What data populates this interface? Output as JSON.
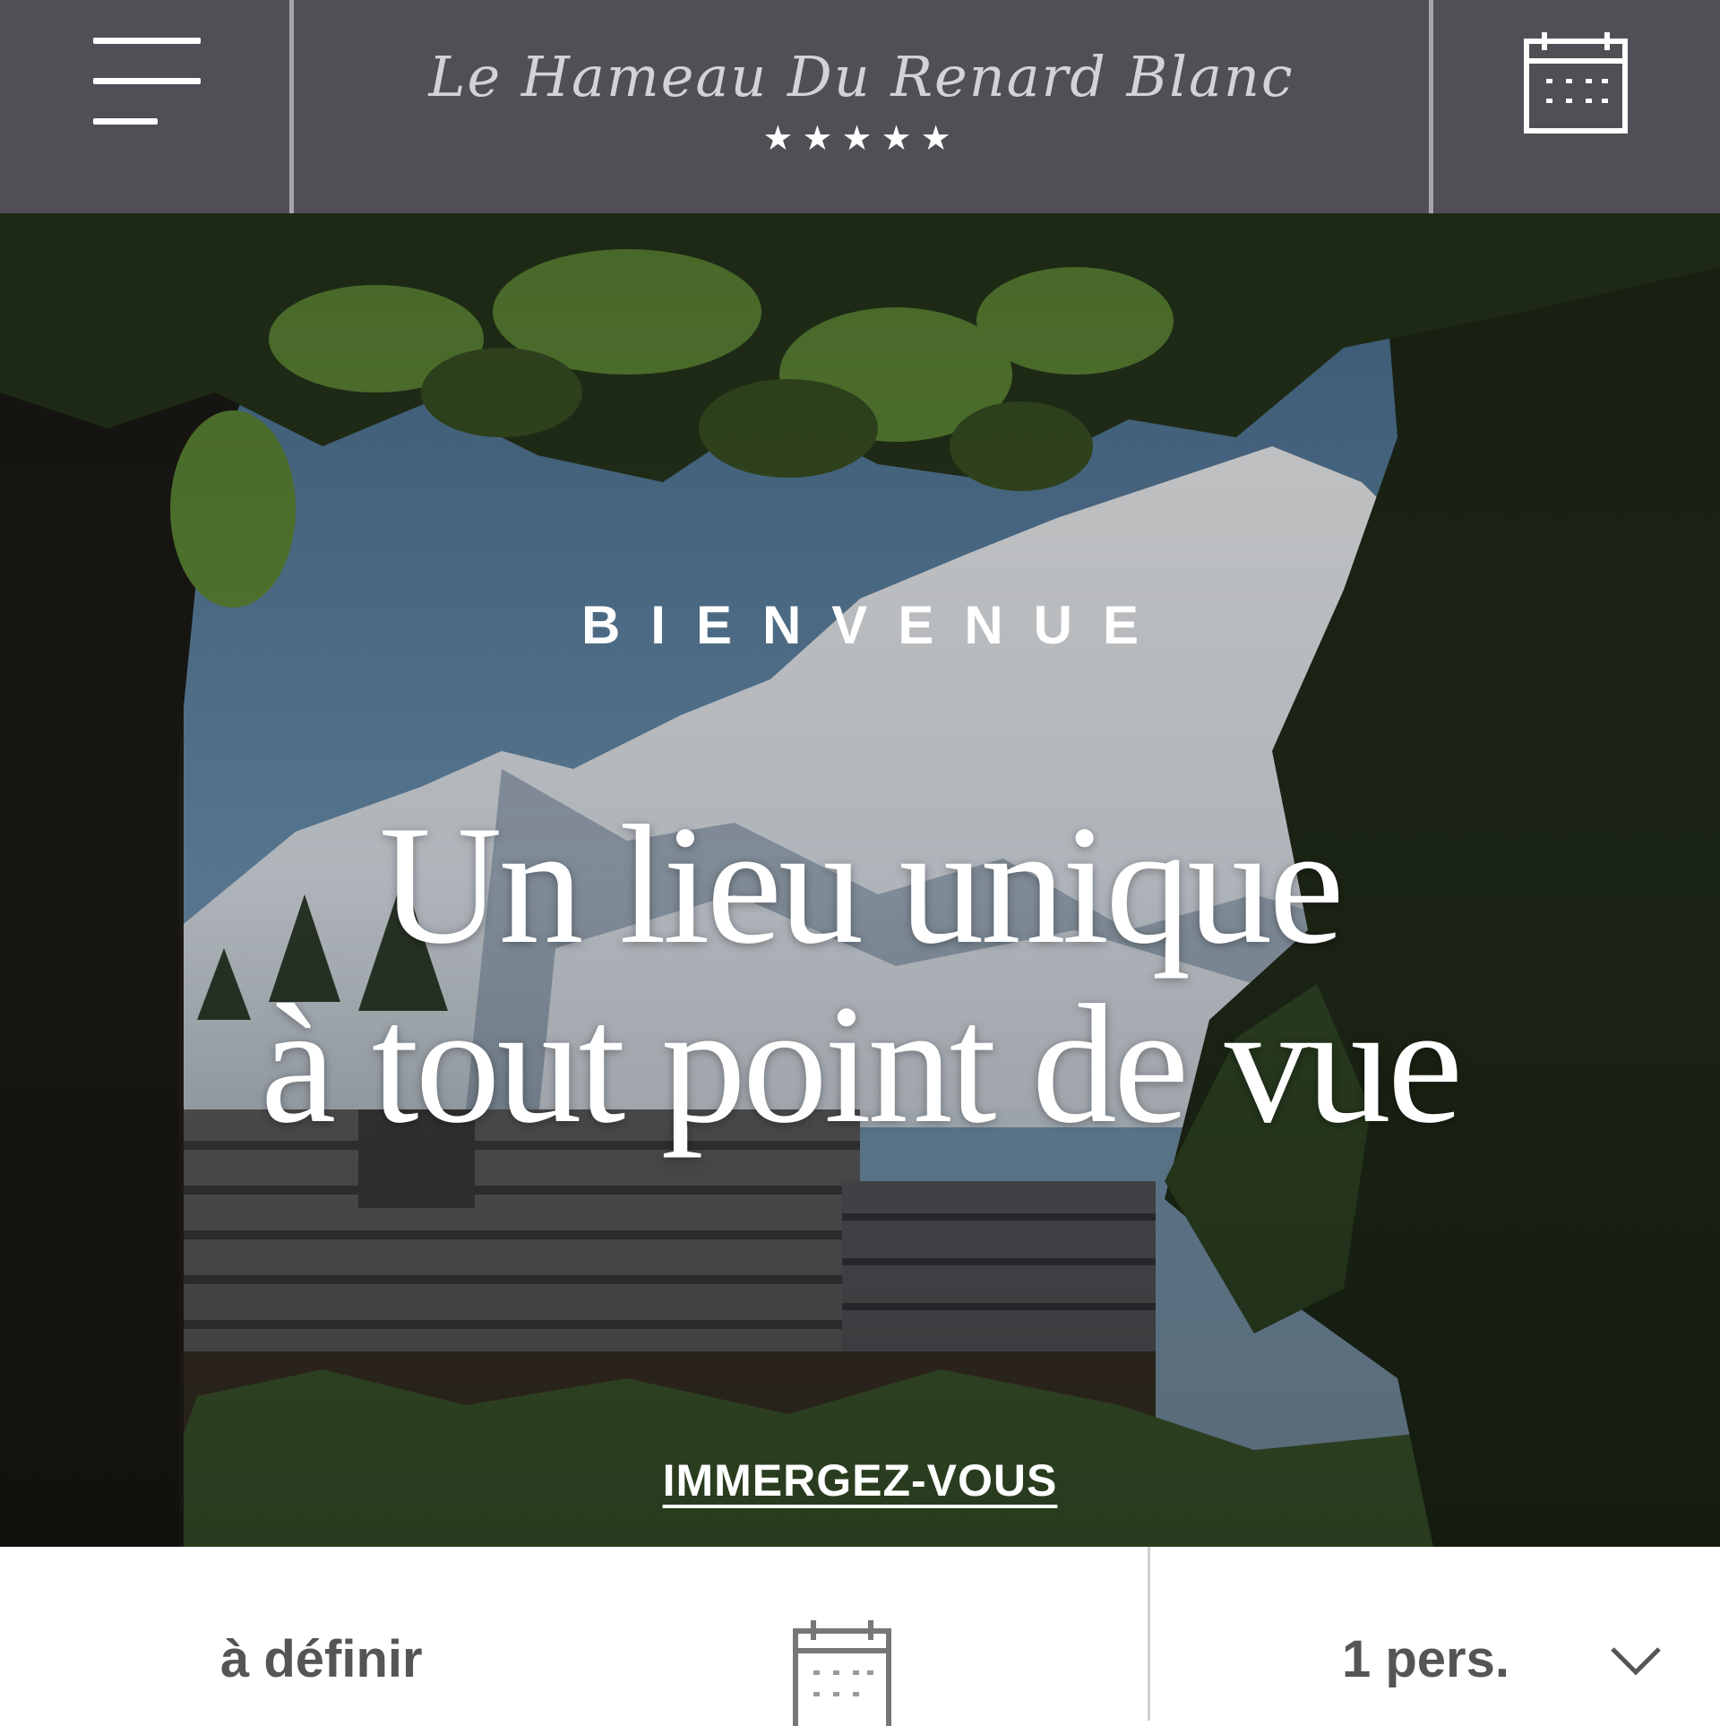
{
  "header": {
    "brand_name": "Le Hameau Du Renard Blanc",
    "rating_stars": "★★★★★",
    "menu_icon": "hamburger-menu-icon",
    "calendar_icon": "calendar-icon"
  },
  "hero": {
    "eyebrow": "BIENVENUE",
    "title_line1": "Un lieu unique",
    "title_line2": "à tout point de vue",
    "cta_label": "IMMERGEZ-VOUS"
  },
  "booking": {
    "dates_label": "à définir",
    "dates_icon": "calendar-icon",
    "guests_label": "1 pers.",
    "guests_icon": "chevron-down-icon"
  },
  "colors": {
    "header_bg": "#514e55",
    "divider": "#a7a5aa",
    "booking_text": "#555558"
  }
}
